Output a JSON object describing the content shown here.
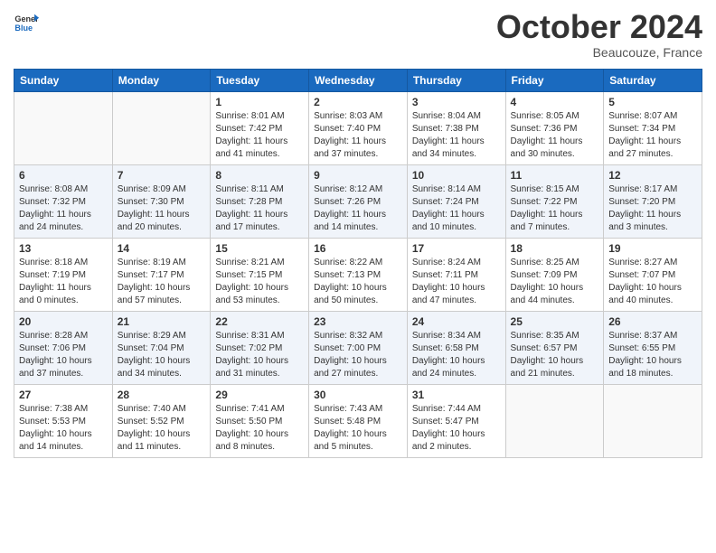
{
  "header": {
    "logo_line1": "General",
    "logo_line2": "Blue",
    "month": "October 2024",
    "location": "Beaucouze, France"
  },
  "days_of_week": [
    "Sunday",
    "Monday",
    "Tuesday",
    "Wednesday",
    "Thursday",
    "Friday",
    "Saturday"
  ],
  "weeks": [
    [
      {
        "day": "",
        "info": ""
      },
      {
        "day": "",
        "info": ""
      },
      {
        "day": "1",
        "sunrise": "Sunrise: 8:01 AM",
        "sunset": "Sunset: 7:42 PM",
        "daylight": "Daylight: 11 hours and 41 minutes."
      },
      {
        "day": "2",
        "sunrise": "Sunrise: 8:03 AM",
        "sunset": "Sunset: 7:40 PM",
        "daylight": "Daylight: 11 hours and 37 minutes."
      },
      {
        "day": "3",
        "sunrise": "Sunrise: 8:04 AM",
        "sunset": "Sunset: 7:38 PM",
        "daylight": "Daylight: 11 hours and 34 minutes."
      },
      {
        "day": "4",
        "sunrise": "Sunrise: 8:05 AM",
        "sunset": "Sunset: 7:36 PM",
        "daylight": "Daylight: 11 hours and 30 minutes."
      },
      {
        "day": "5",
        "sunrise": "Sunrise: 8:07 AM",
        "sunset": "Sunset: 7:34 PM",
        "daylight": "Daylight: 11 hours and 27 minutes."
      }
    ],
    [
      {
        "day": "6",
        "sunrise": "Sunrise: 8:08 AM",
        "sunset": "Sunset: 7:32 PM",
        "daylight": "Daylight: 11 hours and 24 minutes."
      },
      {
        "day": "7",
        "sunrise": "Sunrise: 8:09 AM",
        "sunset": "Sunset: 7:30 PM",
        "daylight": "Daylight: 11 hours and 20 minutes."
      },
      {
        "day": "8",
        "sunrise": "Sunrise: 8:11 AM",
        "sunset": "Sunset: 7:28 PM",
        "daylight": "Daylight: 11 hours and 17 minutes."
      },
      {
        "day": "9",
        "sunrise": "Sunrise: 8:12 AM",
        "sunset": "Sunset: 7:26 PM",
        "daylight": "Daylight: 11 hours and 14 minutes."
      },
      {
        "day": "10",
        "sunrise": "Sunrise: 8:14 AM",
        "sunset": "Sunset: 7:24 PM",
        "daylight": "Daylight: 11 hours and 10 minutes."
      },
      {
        "day": "11",
        "sunrise": "Sunrise: 8:15 AM",
        "sunset": "Sunset: 7:22 PM",
        "daylight": "Daylight: 11 hours and 7 minutes."
      },
      {
        "day": "12",
        "sunrise": "Sunrise: 8:17 AM",
        "sunset": "Sunset: 7:20 PM",
        "daylight": "Daylight: 11 hours and 3 minutes."
      }
    ],
    [
      {
        "day": "13",
        "sunrise": "Sunrise: 8:18 AM",
        "sunset": "Sunset: 7:19 PM",
        "daylight": "Daylight: 11 hours and 0 minutes."
      },
      {
        "day": "14",
        "sunrise": "Sunrise: 8:19 AM",
        "sunset": "Sunset: 7:17 PM",
        "daylight": "Daylight: 10 hours and 57 minutes."
      },
      {
        "day": "15",
        "sunrise": "Sunrise: 8:21 AM",
        "sunset": "Sunset: 7:15 PM",
        "daylight": "Daylight: 10 hours and 53 minutes."
      },
      {
        "day": "16",
        "sunrise": "Sunrise: 8:22 AM",
        "sunset": "Sunset: 7:13 PM",
        "daylight": "Daylight: 10 hours and 50 minutes."
      },
      {
        "day": "17",
        "sunrise": "Sunrise: 8:24 AM",
        "sunset": "Sunset: 7:11 PM",
        "daylight": "Daylight: 10 hours and 47 minutes."
      },
      {
        "day": "18",
        "sunrise": "Sunrise: 8:25 AM",
        "sunset": "Sunset: 7:09 PM",
        "daylight": "Daylight: 10 hours and 44 minutes."
      },
      {
        "day": "19",
        "sunrise": "Sunrise: 8:27 AM",
        "sunset": "Sunset: 7:07 PM",
        "daylight": "Daylight: 10 hours and 40 minutes."
      }
    ],
    [
      {
        "day": "20",
        "sunrise": "Sunrise: 8:28 AM",
        "sunset": "Sunset: 7:06 PM",
        "daylight": "Daylight: 10 hours and 37 minutes."
      },
      {
        "day": "21",
        "sunrise": "Sunrise: 8:29 AM",
        "sunset": "Sunset: 7:04 PM",
        "daylight": "Daylight: 10 hours and 34 minutes."
      },
      {
        "day": "22",
        "sunrise": "Sunrise: 8:31 AM",
        "sunset": "Sunset: 7:02 PM",
        "daylight": "Daylight: 10 hours and 31 minutes."
      },
      {
        "day": "23",
        "sunrise": "Sunrise: 8:32 AM",
        "sunset": "Sunset: 7:00 PM",
        "daylight": "Daylight: 10 hours and 27 minutes."
      },
      {
        "day": "24",
        "sunrise": "Sunrise: 8:34 AM",
        "sunset": "Sunset: 6:58 PM",
        "daylight": "Daylight: 10 hours and 24 minutes."
      },
      {
        "day": "25",
        "sunrise": "Sunrise: 8:35 AM",
        "sunset": "Sunset: 6:57 PM",
        "daylight": "Daylight: 10 hours and 21 minutes."
      },
      {
        "day": "26",
        "sunrise": "Sunrise: 8:37 AM",
        "sunset": "Sunset: 6:55 PM",
        "daylight": "Daylight: 10 hours and 18 minutes."
      }
    ],
    [
      {
        "day": "27",
        "sunrise": "Sunrise: 7:38 AM",
        "sunset": "Sunset: 5:53 PM",
        "daylight": "Daylight: 10 hours and 14 minutes."
      },
      {
        "day": "28",
        "sunrise": "Sunrise: 7:40 AM",
        "sunset": "Sunset: 5:52 PM",
        "daylight": "Daylight: 10 hours and 11 minutes."
      },
      {
        "day": "29",
        "sunrise": "Sunrise: 7:41 AM",
        "sunset": "Sunset: 5:50 PM",
        "daylight": "Daylight: 10 hours and 8 minutes."
      },
      {
        "day": "30",
        "sunrise": "Sunrise: 7:43 AM",
        "sunset": "Sunset: 5:48 PM",
        "daylight": "Daylight: 10 hours and 5 minutes."
      },
      {
        "day": "31",
        "sunrise": "Sunrise: 7:44 AM",
        "sunset": "Sunset: 5:47 PM",
        "daylight": "Daylight: 10 hours and 2 minutes."
      },
      {
        "day": "",
        "info": ""
      },
      {
        "day": "",
        "info": ""
      }
    ]
  ]
}
